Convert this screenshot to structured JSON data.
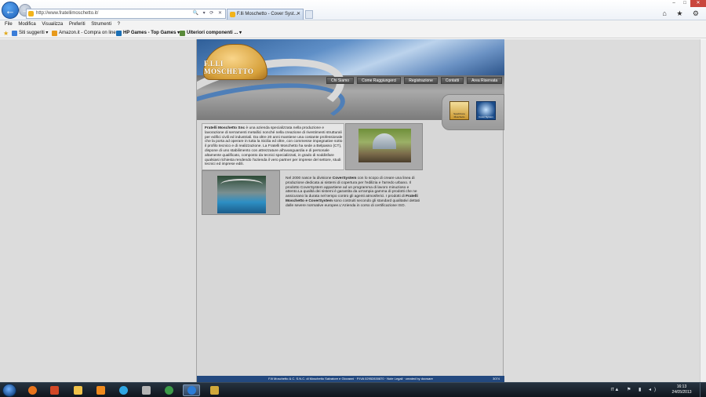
{
  "browser": {
    "address_url": "http://www.fratellimoschetto.it/",
    "tab_title": "F.lli Moschetto - Cover Syst...",
    "address_tools": "🔍 ▾ ⟳ ✕",
    "right_icons": "⌂ ★ ⚙"
  },
  "window_controls": {
    "minimize": "–",
    "maximize": "□",
    "close": "✕"
  },
  "menubar": {
    "items": [
      "File",
      "Modifica",
      "Visualizza",
      "Preferiti",
      "Strumenti",
      "?"
    ]
  },
  "favorites": {
    "items": [
      {
        "label": "Siti suggeriti ▾",
        "color": "#3b7dd8"
      },
      {
        "label": "Amazon.it - Compra on line",
        "color": "#e79a1d"
      },
      {
        "label": "HP Games - Top Games ▾",
        "color": "#1b6fb5"
      },
      {
        "label": "Ulteriori componenti ... ▾",
        "color": "#5a8a3a"
      }
    ]
  },
  "site": {
    "logo_text": "F.LLI MOSCHETTO",
    "nav": [
      "Chi Siamo",
      "Come Raggiungerci",
      "Registrazione",
      "Contatti",
      "Area Riservata"
    ],
    "thumb_captions": [
      "Spedizione Moschetto",
      "Cover System"
    ],
    "para1_lead": "Fratelli Moschetto Snc",
    "para1_body": " è una azienda specializzata nella produzione e lavorazione di serramenti metallici nonché nella creazione di rivestimenti strutturali per edifici civili ed industriali. Da oltre 20 anni mantiene una costante professionale che la porta ad operare in tutta la Sicilia ed oltre, con commesse impegnative sotto il profilo tecnico e di realizzazione. La Fratelli Moschetto ha sede a Belpasso (CT), dispone di uno stabilimento con attrezzature all'avanguardia e di personale altamente qualificato, composto da tecnici specializzati, in grado di soddisfare qualsiasi richiesta rendendo l'azienda il vero partner per imprese del settore, studi tecnici ed imprese edili.",
    "para2_intro": "Nel 2000 nasce la divisione ",
    "para2_brand": "CoverSystem",
    "para2_mid": " con lo scopo di creare una linea di produzione dedicata ai sistemi di copertura per l'edilizia e l'arredo urbano. Il prodotto CoverSystem appartiene ad un programma di lavoro minuzioso e attento.La qualità dei sistemi è garantita da un'ampia gamma di prodotti che ne assicurano la durata nel tempo contro gli agenti atmosferici. I prodotti di ",
    "para2_brand2": "Fratelli Moschetto e CoverSystem",
    "para2_end": " sono costruiti secondo gli standard qualitativi dettati dalle severe normative europee.L'Azienda in corso di certificazione ISO.",
    "footer_text": "F.lli Moschetto & C. S.N.C. di Moschetto Salvatore e Giovanni  ·  P.IVA 02952830870  ·  Note Legali  ·  created by docware",
    "footer_code": "3074"
  },
  "taskbar": {
    "apps": [
      {
        "name": "firefox",
        "color": "#e8741c"
      },
      {
        "name": "office",
        "color": "#d24726"
      },
      {
        "name": "explorer",
        "color": "#f0c24a"
      },
      {
        "name": "media-player",
        "color": "#f08a1d"
      },
      {
        "name": "skype",
        "color": "#2fa6e3"
      },
      {
        "name": "printer",
        "color": "#b4b4b4"
      },
      {
        "name": "chrome",
        "color": "#3c9b48"
      },
      {
        "name": "internet-explorer",
        "color": "#2b7bd6"
      },
      {
        "name": "fireworks",
        "color": "#d0a83a"
      }
    ],
    "language": "IT",
    "tray_icons": "▲ ⚑ ▮ ◂)",
    "time": "16:13",
    "date": "24/05/2013"
  }
}
